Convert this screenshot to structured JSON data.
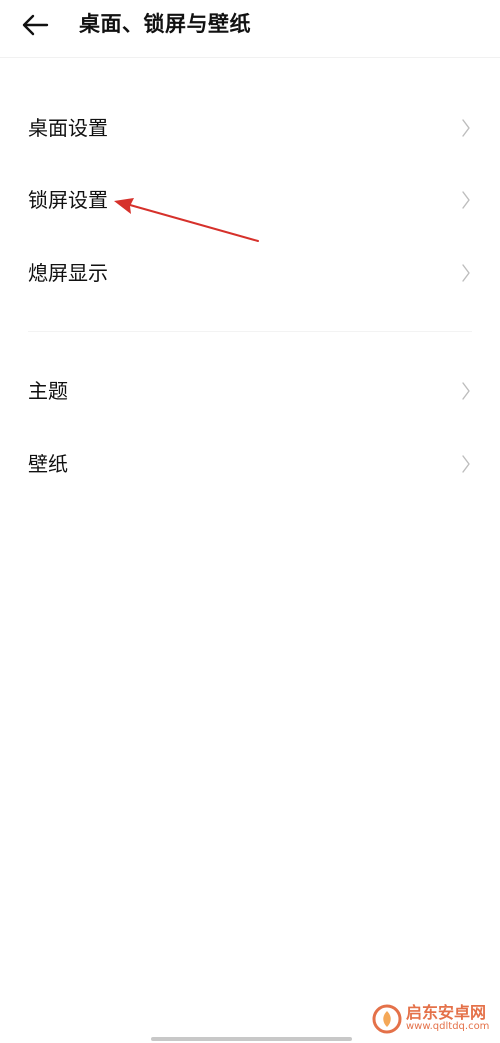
{
  "header": {
    "title": "桌面、锁屏与壁纸",
    "back_icon": "arrow-left-icon"
  },
  "menu": {
    "group1": [
      {
        "label": "桌面设置"
      },
      {
        "label": "锁屏设置"
      },
      {
        "label": "熄屏显示"
      }
    ],
    "group2": [
      {
        "label": "主题"
      },
      {
        "label": "壁纸"
      }
    ],
    "chevron_icon": "chevron-right-icon"
  },
  "annotation": {
    "color": "#d6312b",
    "icon": "red-arrow-pointer"
  },
  "watermark": {
    "name": "启东安卓网",
    "url": "www.qdltdq.com",
    "color": "#e0592a"
  },
  "colors": {
    "background": "#ffffff",
    "text": "#111111",
    "chevron": "#bdbdbd"
  }
}
